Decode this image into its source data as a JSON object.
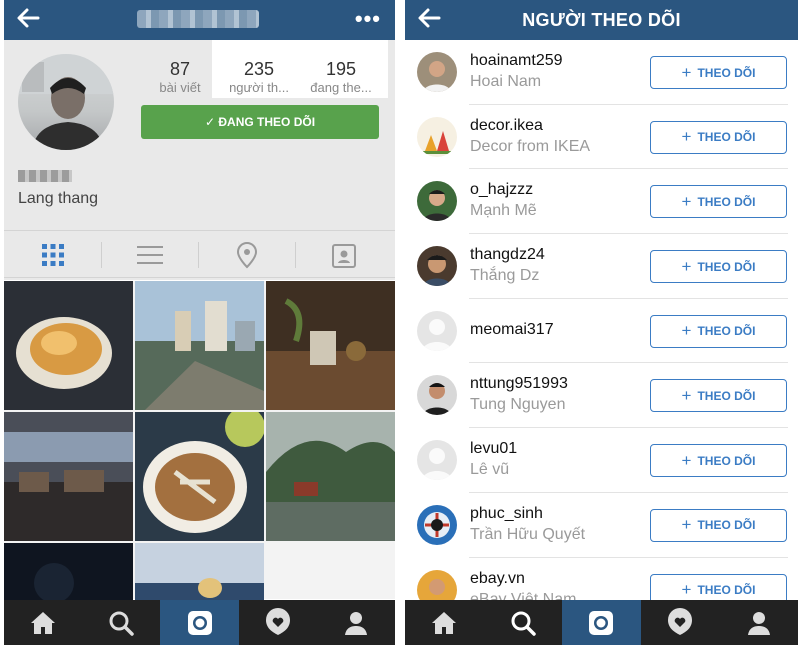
{
  "left": {
    "stats": [
      {
        "num": "87",
        "label": "bài viết"
      },
      {
        "num": "235",
        "label": "người th..."
      },
      {
        "num": "195",
        "label": "đang the..."
      }
    ],
    "following_button": "ĐANG THEO DÕI",
    "bio": "Lang thang",
    "colors": {
      "topbar": "#2b5680",
      "following_button": "#58a24c"
    }
  },
  "right": {
    "title": "NGƯỜI THEO DÕI",
    "follow_label": "THEO DÕI",
    "followers": [
      {
        "username": "hoainamt259",
        "name": "Hoai Nam"
      },
      {
        "username": "decor.ikea",
        "name": "Decor from IKEA"
      },
      {
        "username": "o_hajzzz",
        "name": "Mạnh Mẽ"
      },
      {
        "username": "thangdz24",
        "name": "Thắng Dz"
      },
      {
        "username": "meomai317",
        "name": ""
      },
      {
        "username": "nttung951993",
        "name": "Tung Nguyen"
      },
      {
        "username": "levu01",
        "name": "Lê vũ"
      },
      {
        "username": "phuc_sinh",
        "name": "Trần Hữu Quyết"
      },
      {
        "username": "ebay.vn",
        "name": "eBay Việt Nam"
      }
    ],
    "colors": {
      "follow_button": "#3b7cc4",
      "active_tab": "#2b5680"
    }
  }
}
